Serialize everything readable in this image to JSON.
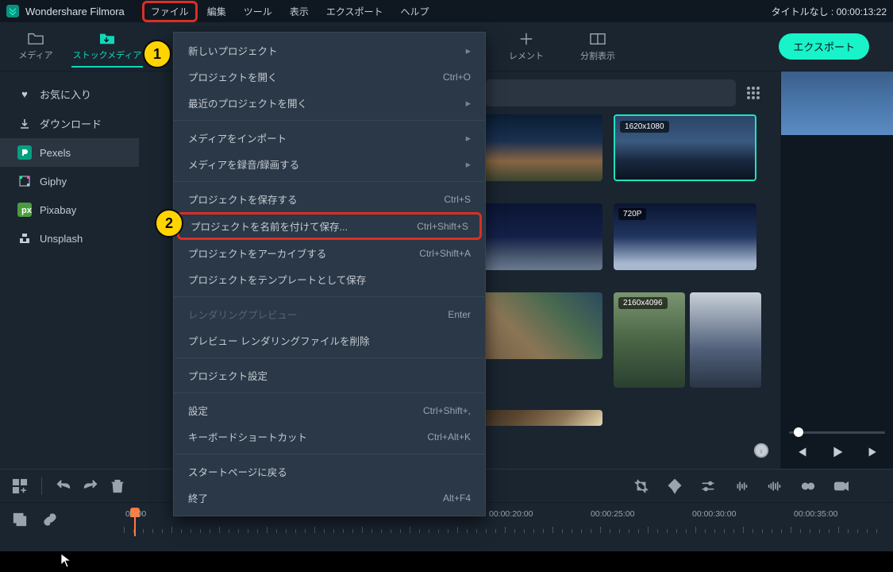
{
  "app": {
    "title": "Wondershare Filmora"
  },
  "titleRight": "タイトルなし : 00:00:13:22",
  "menubar": [
    "ファイル",
    "編集",
    "ツール",
    "表示",
    "エクスポート",
    "ヘルプ"
  ],
  "toolTabs": {
    "media": "メディア",
    "stock": "ストックメディア",
    "element": "レメント",
    "split": "分割表示"
  },
  "exportLabel": "エクスポート",
  "sidebar": {
    "fav": "お気に入り",
    "dl": "ダウンロード",
    "pexels": "Pexels",
    "giphy": "Giphy",
    "pixabay": "Pixabay",
    "unsplash": "Unsplash"
  },
  "badges": {
    "r1": "1620x1080",
    "r2": "720P",
    "r3": "2160x4096"
  },
  "dropdown": {
    "newProject": "新しいプロジェクト",
    "openProject": "プロジェクトを開く",
    "openProjectKey": "Ctrl+O",
    "recent": "最近のプロジェクトを開く",
    "importMedia": "メディアをインポート",
    "recordMedia": "メディアを録音/録画する",
    "saveProject": "プロジェクトを保存する",
    "saveProjectKey": "Ctrl+S",
    "saveAs": "プロジェクトを名前を付けて保存...",
    "saveAsKey": "Ctrl+Shift+S",
    "archive": "プロジェクトをアーカイブする",
    "archiveKey": "Ctrl+Shift+A",
    "saveTemplate": "プロジェクトをテンプレートとして保存",
    "renderPreview": "レンダリングプレビュー",
    "renderPreviewKey": "Enter",
    "deleteRender": "プレビュー レンダリングファイルを削除",
    "projectSettings": "プロジェクト設定",
    "settings": "設定",
    "settingsKey": "Ctrl+Shift+,",
    "shortcuts": "キーボードショートカット",
    "shortcutsKey": "Ctrl+Alt+K",
    "startPage": "スタートページに戻る",
    "exit": "終了",
    "exitKey": "Alt+F4"
  },
  "annotations": {
    "b1": "1",
    "b2": "2"
  },
  "timeline": {
    "t0": "00:00",
    "t20": "00:00:20:00",
    "t25": "00:00:25:00",
    "t30": "00:00:30:00",
    "t35": "00:00:35:00"
  }
}
